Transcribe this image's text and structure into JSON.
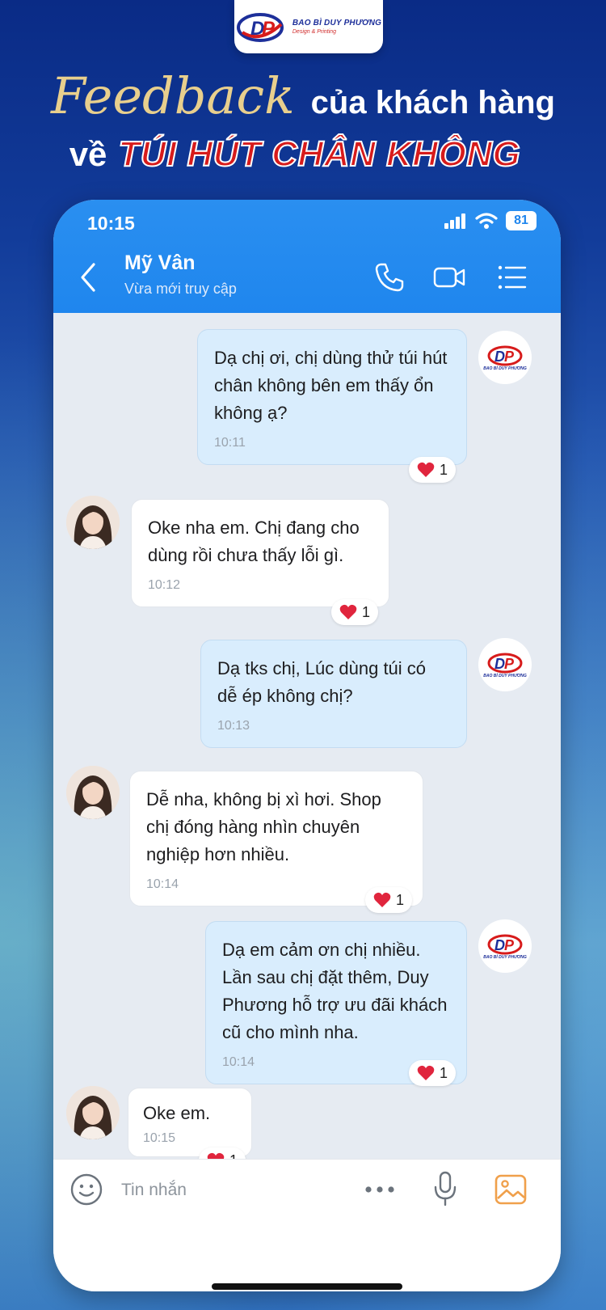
{
  "brand": {
    "name": "BAO BÌ DUY PHƯƠNG",
    "tagline": "Design & Printing"
  },
  "headline": {
    "feedback": "Feedback",
    "line1_rest": "của khách hàng",
    "line2_prefix": "về",
    "product": "TÚI HÚT CHÂN KHÔNG"
  },
  "status_bar": {
    "time": "10:15",
    "battery": "81"
  },
  "header": {
    "contact_name": "Mỹ Vân",
    "contact_status": "Vừa mới truy cập"
  },
  "messages": [
    {
      "from": "shop",
      "text": "Dạ chị ơi, chị dùng thử túi hút chân không bên em thấy ổn không ạ?",
      "time": "10:11",
      "reaction": "1"
    },
    {
      "from": "customer",
      "text": "Oke nha em. Chị đang cho dùng rồi chưa thấy lỗi gì.",
      "time": "10:12",
      "reaction": "1"
    },
    {
      "from": "shop",
      "text": "Dạ tks chị, Lúc dùng túi có dễ ép không chị?",
      "time": "10:13"
    },
    {
      "from": "customer",
      "text": "Dễ nha, không bị xì hơi. Shop chị đóng hàng nhìn chuyên nghiệp hơn nhiều.",
      "time": "10:14",
      "reaction": "1"
    },
    {
      "from": "shop",
      "text": "Dạ em cảm ơn chị nhiều. Lần sau chị đặt thêm, Duy Phương hỗ trợ ưu đãi khách cũ cho mình nha.",
      "time": "10:14",
      "reaction": "1"
    },
    {
      "from": "customer",
      "text": "Oke em.",
      "time": "10:15",
      "reaction": "1"
    }
  ],
  "input": {
    "placeholder": "Tin nhắn"
  },
  "icons": {
    "back": "chevron-left-icon",
    "call": "phone-icon",
    "video": "video-icon",
    "menu": "list-icon",
    "emoji": "smiley-icon",
    "more": "more-dots-icon",
    "mic": "microphone-icon",
    "image": "image-icon",
    "reaction": "heart-icon"
  },
  "colors": {
    "header_blue": "#1f86ee",
    "outgoing_bubble": "#d9edfd",
    "incoming_bubble": "#ffffff",
    "heart": "#e0253d",
    "product_red": "#d71b1b",
    "gold": "#e8cf8d"
  }
}
